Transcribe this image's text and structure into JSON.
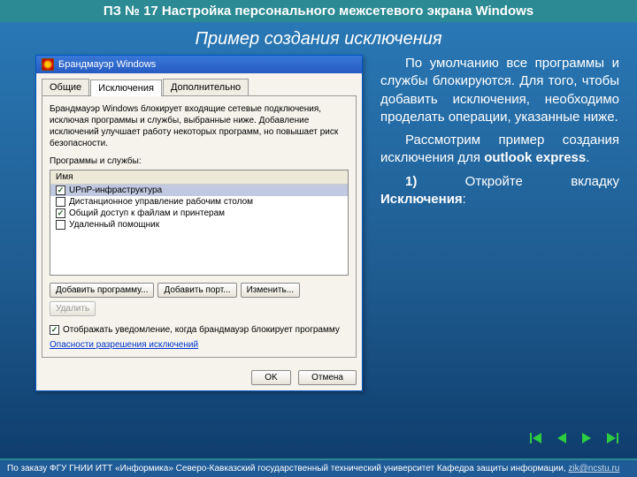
{
  "header": "ПЗ № 17 Настройка персонального межсетевого экрана Windows",
  "subtitle": "Пример создания исключения",
  "window": {
    "title": "Брандмауэр Windows",
    "tabs": [
      "Общие",
      "Исключения",
      "Дополнительно"
    ],
    "desc": "Брандмауэр Windows блокирует входящие сетевые подключения, исключая программы и службы, выбранные ниже. Добавление исключений улучшает работу некоторых программ, но повышает риск безопасности.",
    "list_label": "Программы и службы:",
    "col_header": "Имя",
    "items": [
      {
        "label": "UPnP-инфраструктура",
        "checked": true,
        "selected": true
      },
      {
        "label": "Дистанционное управление рабочим столом",
        "checked": false,
        "selected": false
      },
      {
        "label": "Общий доступ к файлам и принтерам",
        "checked": true,
        "selected": false
      },
      {
        "label": "Удаленный помощник",
        "checked": false,
        "selected": false
      }
    ],
    "buttons": {
      "add_program": "Добавить программу...",
      "add_port": "Добавить порт...",
      "edit": "Изменить...",
      "delete": "Удалить"
    },
    "notify_checkbox": "Отображать уведомление, когда брандмауэр блокирует программу",
    "risk_link": "Опасности разрешения исключений",
    "ok": "OK",
    "cancel": "Отмена"
  },
  "side": {
    "p1": "По умолчанию все программы и службы блокируются. Для того, чтобы добавить исключения, необходимо проделать операции, указанные ниже.",
    "p2a": "Рассмотрим пример создания исключения для ",
    "p2b": "outlook express",
    "p2c": ".",
    "p3a": "1)",
    "p3b": " Откройте вкладку ",
    "p3c": "Исключения",
    "p3d": ":"
  },
  "footer": {
    "text": "По заказу ФГУ ГНИИ ИТТ «Информика» Северо-Кавказский государственный технический университет Кафедра защиты информации, ",
    "email": "zik@ncstu.ru"
  }
}
